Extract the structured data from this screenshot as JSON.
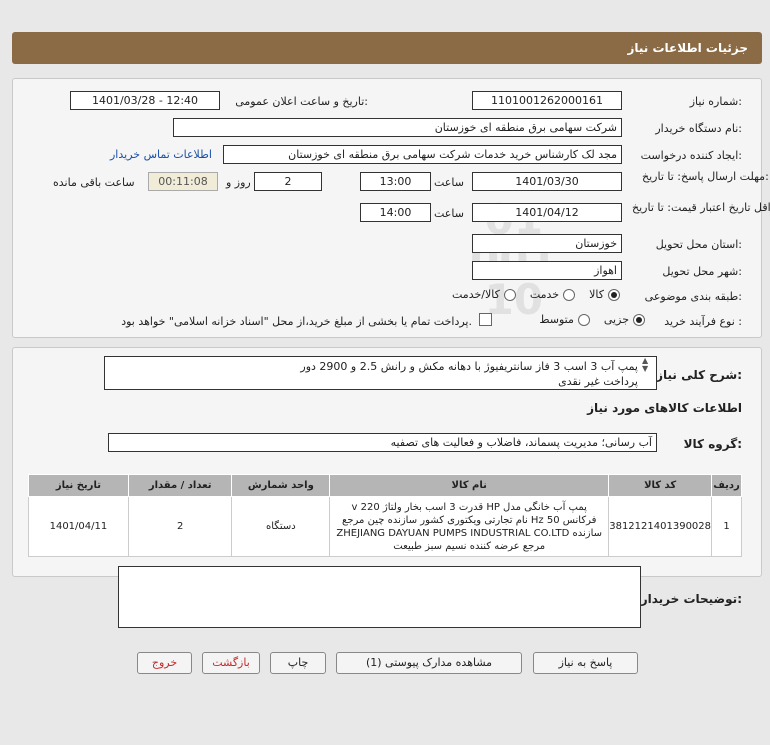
{
  "header": {
    "title": "جزئیات اطلاعات نیاز"
  },
  "form": {
    "need_number": {
      "label": "شماره نیاز:",
      "value": "1101001262000161"
    },
    "announce": {
      "label": "تاریخ و ساعت اعلان عمومی:",
      "value": "1401/03/28 - 12:40"
    },
    "buyer": {
      "label": "نام دستگاه خریدار:",
      "value": "شرکت سهامی برق منطقه ای خوزستان"
    },
    "creator": {
      "label": "ایجاد کننده درخواست:",
      "value": "مجد لک کارشناس خرید خدمات شرکت سهامی برق منطقه ای خوزستان",
      "link": "اطلاعات تماس خریدار"
    },
    "deadline": {
      "label": "مهلت ارسال پاسخ: تا تاریخ:",
      "date": "1401/03/30",
      "time_label": "ساعت",
      "time": "13:00",
      "days": "2",
      "days_label": "روز و",
      "remaining": "00:11:08",
      "remaining_label": "ساعت باقی مانده"
    },
    "validity": {
      "label": "حداقل تاریخ اعتبار قیمت: تا تاریخ:",
      "date": "1401/04/12",
      "time_label": "ساعت",
      "time": "14:00"
    },
    "province": {
      "label": "استان محل تحویل:",
      "value": "خوزستان"
    },
    "city": {
      "label": "شهر محل تحویل:",
      "value": "اهواز"
    },
    "category": {
      "label": "طبقه بندی موضوعی:",
      "options": [
        "کالا",
        "خدمت",
        "کالا/خدمت"
      ],
      "selected": "کالا"
    },
    "process": {
      "label": "نوع فرآیند خرید :",
      "options": [
        "جزیی",
        "متوسط"
      ],
      "selected": "جزیی",
      "note": "پرداخت تمام یا بخشی از مبلغ خرید،از محل \"اسناد خزانه اسلامی\" خواهد بود."
    }
  },
  "desc": {
    "label": "شرح کلی نیاز:",
    "line1": "پمپ آب 3  اسب  3 فاز  سانتریفیوژ با دهانه مکش و رانش 2.5 و 2900 دور",
    "line2": "پرداخت غیر نقدی"
  },
  "goods": {
    "section_title": "اطلاعات کالاهای مورد نیاز",
    "group_label": "گروه کالا:",
    "group_value": "آب رسانی؛ مدیریت پسماند، فاضلاب و فعالیت های تصفیه",
    "columns": [
      "ردیف",
      "کد کالا",
      "نام کالا",
      "واحد شمارش",
      "تعداد / مقدار",
      "تاریخ نیاز"
    ],
    "rows": [
      {
        "index": "1",
        "code": "3812121401390028",
        "name_lines": [
          "پمپ آب خانگی مدل HP قدرت 3 اسب بخار ولتاژ 220 v",
          "فرکانس Hz 50 نام تجارتی ویکتوری کشور سازنده چین مرجع",
          "سازنده ZHEJIANG DAYUAN PUMPS INDUSTRIAL CO.LTD",
          "مرجع عرضه کننده نسیم سبز طبیعت"
        ],
        "unit": "دستگاه",
        "qty": "2",
        "date": "1401/04/11"
      }
    ]
  },
  "buyer_notes": {
    "label": "توضیحات خریدار:",
    "value": ""
  },
  "buttons": {
    "reply": "پاسخ به نیاز",
    "attachments": "مشاهده مدارک پیوستی (1)",
    "print": "چاپ",
    "back": "بازگشت",
    "exit": "خروج"
  }
}
